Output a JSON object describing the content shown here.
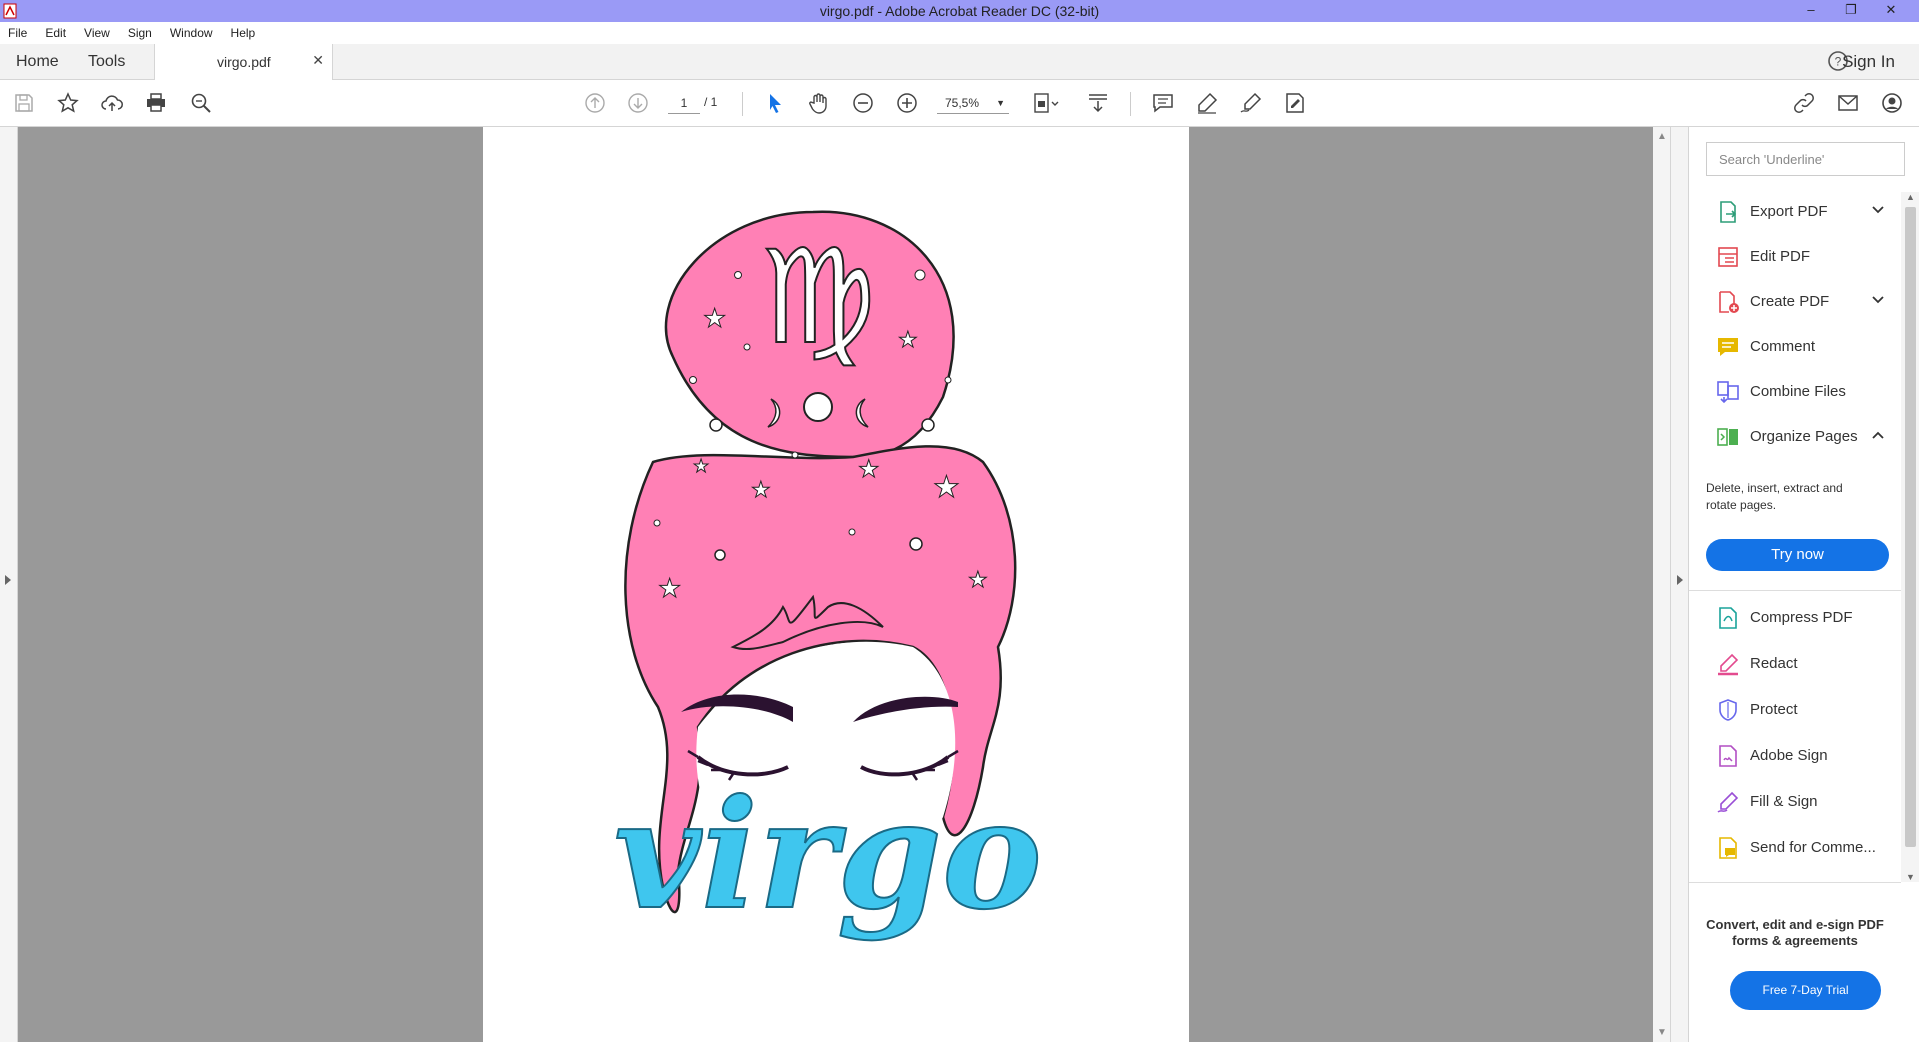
{
  "window": {
    "title": "virgo.pdf - Adobe Acrobat Reader DC (32-bit)"
  },
  "menu": {
    "items": [
      "File",
      "Edit",
      "View",
      "Sign",
      "Window",
      "Help"
    ]
  },
  "tabs": {
    "home": "Home",
    "tools": "Tools",
    "document": "virgo.pdf",
    "signin": "Sign In"
  },
  "toolbar": {
    "page_current": "1",
    "page_total": "/ 1",
    "zoom": "75,5%"
  },
  "document": {
    "artwork_text": "virgo"
  },
  "pane": {
    "search_placeholder": "Search 'Underline'",
    "tools": [
      {
        "label": "Export PDF",
        "icon": "export-pdf-icon",
        "color": "#2d9d78"
      },
      {
        "label": "Edit PDF",
        "icon": "edit-pdf-icon",
        "color": "#e34850"
      },
      {
        "label": "Create PDF",
        "icon": "create-pdf-icon",
        "color": "#e34850"
      },
      {
        "label": "Comment",
        "icon": "comment-icon",
        "color": "#e6b800"
      },
      {
        "label": "Combine Files",
        "icon": "combine-files-icon",
        "color": "#6767ec"
      },
      {
        "label": "Organize Pages",
        "icon": "organize-pages-icon",
        "color": "#4caf50"
      },
      {
        "label": "Compress PDF",
        "icon": "compress-pdf-icon",
        "color": "#1aa39a"
      },
      {
        "label": "Redact",
        "icon": "redact-icon",
        "color": "#e34b8f"
      },
      {
        "label": "Protect",
        "icon": "protect-icon",
        "color": "#6767ec"
      },
      {
        "label": "Adobe Sign",
        "icon": "adobe-sign-icon",
        "color": "#b24fc4"
      },
      {
        "label": "Fill & Sign",
        "icon": "fill-sign-icon",
        "color": "#9a4fd6"
      },
      {
        "label": "Send for Comme...",
        "icon": "send-for-comment-icon",
        "color": "#e6b800"
      }
    ],
    "organize_desc": "Delete, insert, extract and rotate pages.",
    "try_now": "Try now",
    "promo_text": "Convert, edit and e-sign PDF forms & agreements",
    "trial_button": "Free 7-Day Trial"
  },
  "colors": {
    "accent": "#1473e6",
    "hair": "#ff80b5",
    "virgo_text": "#3fc6ee",
    "titlebar": "#9a9af6"
  }
}
